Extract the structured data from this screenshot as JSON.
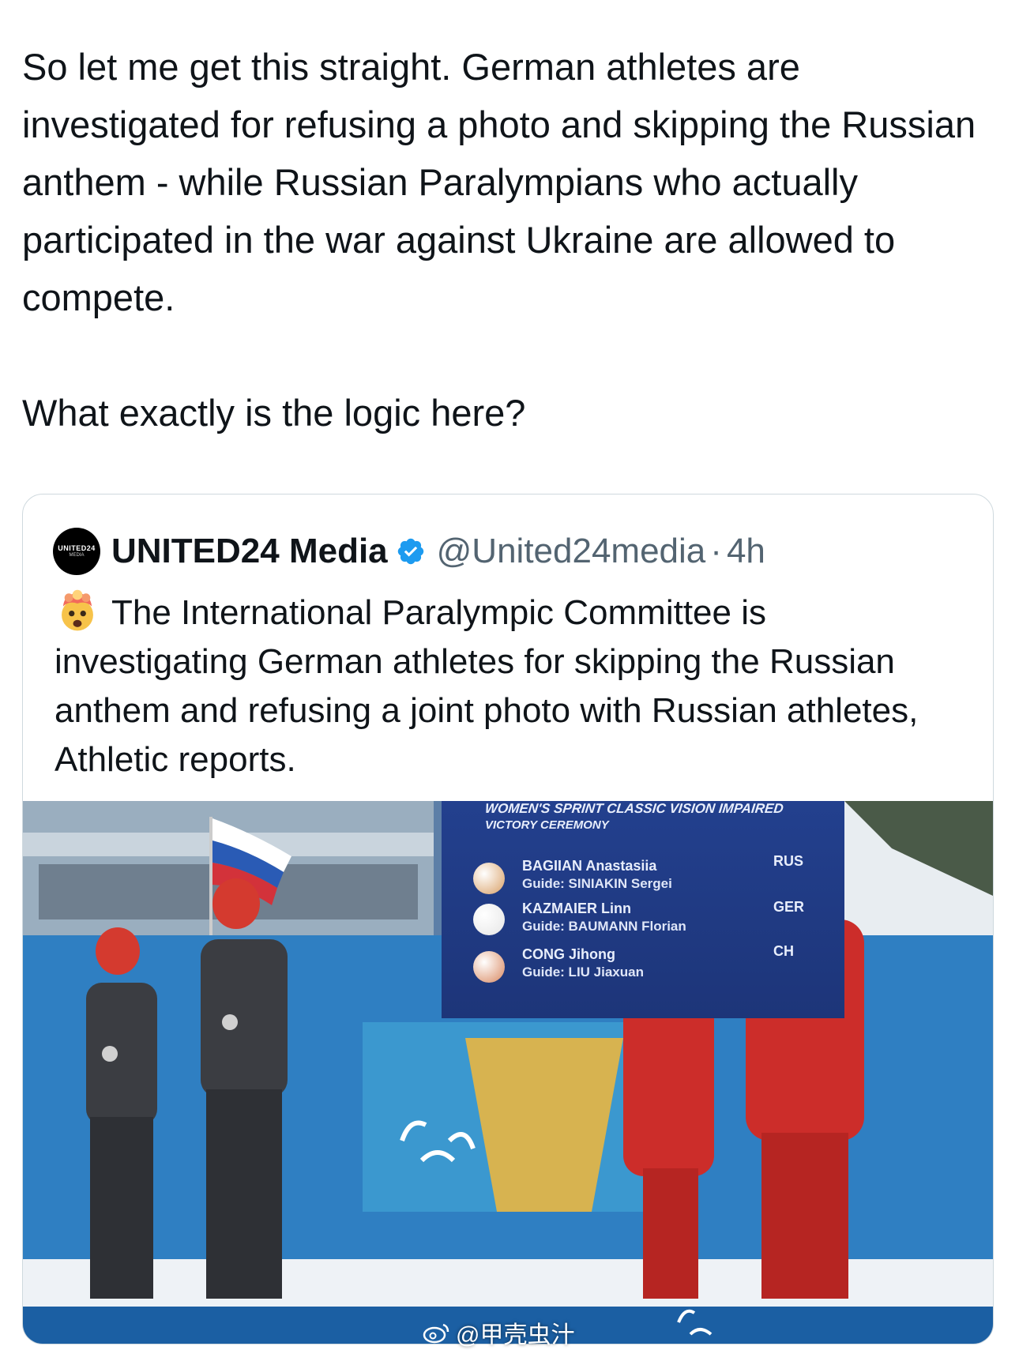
{
  "post": {
    "text": "So let me get this straight. German athletes are investigated for refusing a photo and skipping the Russian anthem - while Russian Paralympians who actually participated in the war against Ukraine are allowed to compete.\n\nWhat exactly is the logic here?"
  },
  "quoted": {
    "avatar_text": "UNITED24",
    "avatar_sub": "MEDIA",
    "name": "UNITED24 Media",
    "verified_icon": "verified-badge-icon",
    "handle": "@United24media",
    "separator": "·",
    "time": "4h",
    "emoji_icon": "exploding-head-emoji",
    "text": "The International Paralympic Committee is investigating German athletes for skipping the Russian anthem and refusing a joint photo with Russian athletes, Athletic reports.",
    "image": {
      "board_title": "WOMEN'S SPRINT CLASSIC VISION IMPAIRED",
      "board_subtitle": "VICTORY CEREMONY",
      "results": [
        {
          "name": "BAGIIAN Anastasiia",
          "guide": "Guide: SINIAKIN Sergei",
          "nation": "RUS",
          "medal_color": "#d9a066"
        },
        {
          "name": "KAZMAIER Linn",
          "guide": "Guide: BAUMANN Florian",
          "nation": "GER",
          "medal_color": "#e6e6e6"
        },
        {
          "name": "CONG Jihong",
          "guide": "Guide: LIU Jiaxuan",
          "nation": "CH",
          "medal_color": "#d98860"
        }
      ]
    }
  },
  "watermark": {
    "icon": "weibo-icon",
    "text": "@甲壳虫汁"
  }
}
